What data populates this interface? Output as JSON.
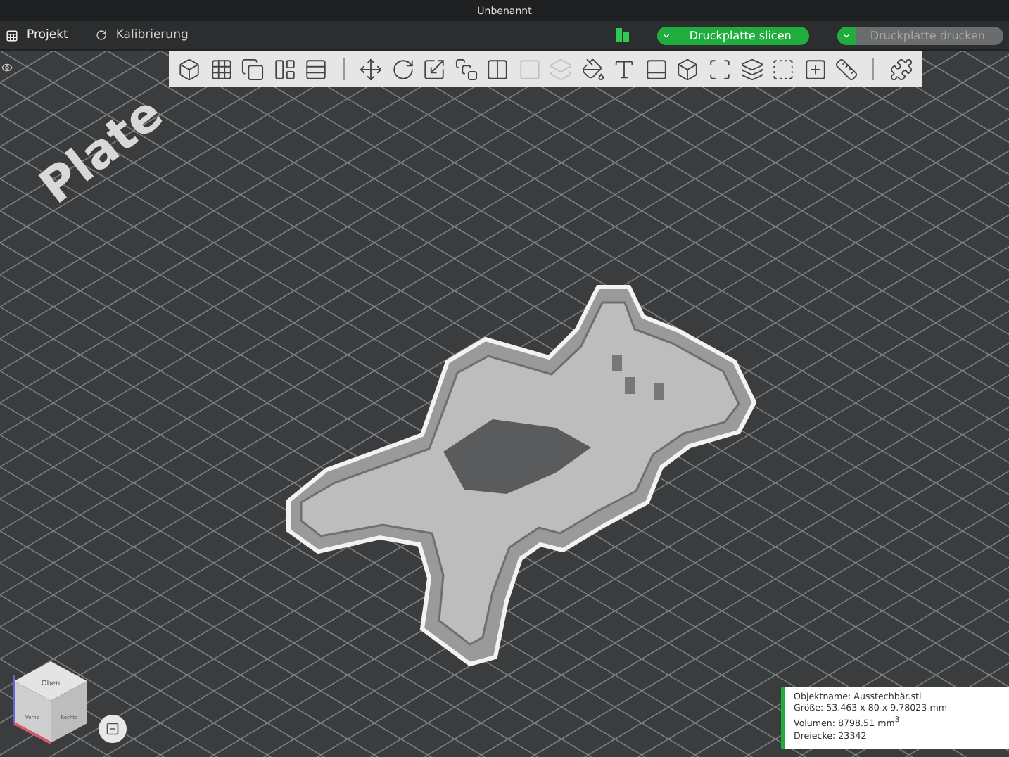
{
  "window": {
    "title": "Unbenannt"
  },
  "tabs": [
    {
      "label": "Projekt",
      "selected": true
    },
    {
      "label": "Kalibrierung",
      "selected": false
    }
  ],
  "actions": [
    {
      "label": "Druckplatte slicen",
      "disabled": false
    },
    {
      "label": "Druckplatte drucken",
      "disabled": true
    }
  ],
  "toolbar": [
    {
      "kind": "icon",
      "disabled": false
    },
    {
      "kind": "icon",
      "disabled": false
    },
    {
      "kind": "icon",
      "disabled": false
    },
    {
      "kind": "icon",
      "disabled": false
    },
    {
      "kind": "icon",
      "disabled": false
    },
    {
      "kind": "separator"
    },
    {
      "kind": "icon",
      "disabled": false
    },
    {
      "kind": "icon",
      "disabled": false
    },
    {
      "kind": "icon",
      "disabled": false
    },
    {
      "kind": "icon",
      "disabled": false
    },
    {
      "kind": "icon",
      "disabled": false
    },
    {
      "kind": "icon",
      "disabled": true
    },
    {
      "kind": "icon",
      "disabled": true
    },
    {
      "kind": "icon",
      "disabled": false
    },
    {
      "kind": "icon",
      "disabled": false
    },
    {
      "kind": "icon",
      "disabled": false
    },
    {
      "kind": "icon",
      "disabled": false
    },
    {
      "kind": "icon",
      "disabled": false
    },
    {
      "kind": "icon",
      "disabled": false
    },
    {
      "kind": "icon",
      "disabled": false
    },
    {
      "kind": "icon",
      "disabled": false
    },
    {
      "kind": "icon",
      "disabled": false
    },
    {
      "kind": "separator"
    },
    {
      "kind": "icon",
      "disabled": false
    }
  ],
  "bed_label": "Plate",
  "view_cube": {
    "top": "Oben",
    "front": "Vorne",
    "right": "Rechts"
  },
  "object_info": [
    "Objektname: Ausstechbär.stl",
    "Größe: 53.463 x 80 x 9.78023 mm",
    "Volumen: 8798.51 mm$^{3}$",
    "Dreiecke: 23342"
  ]
}
